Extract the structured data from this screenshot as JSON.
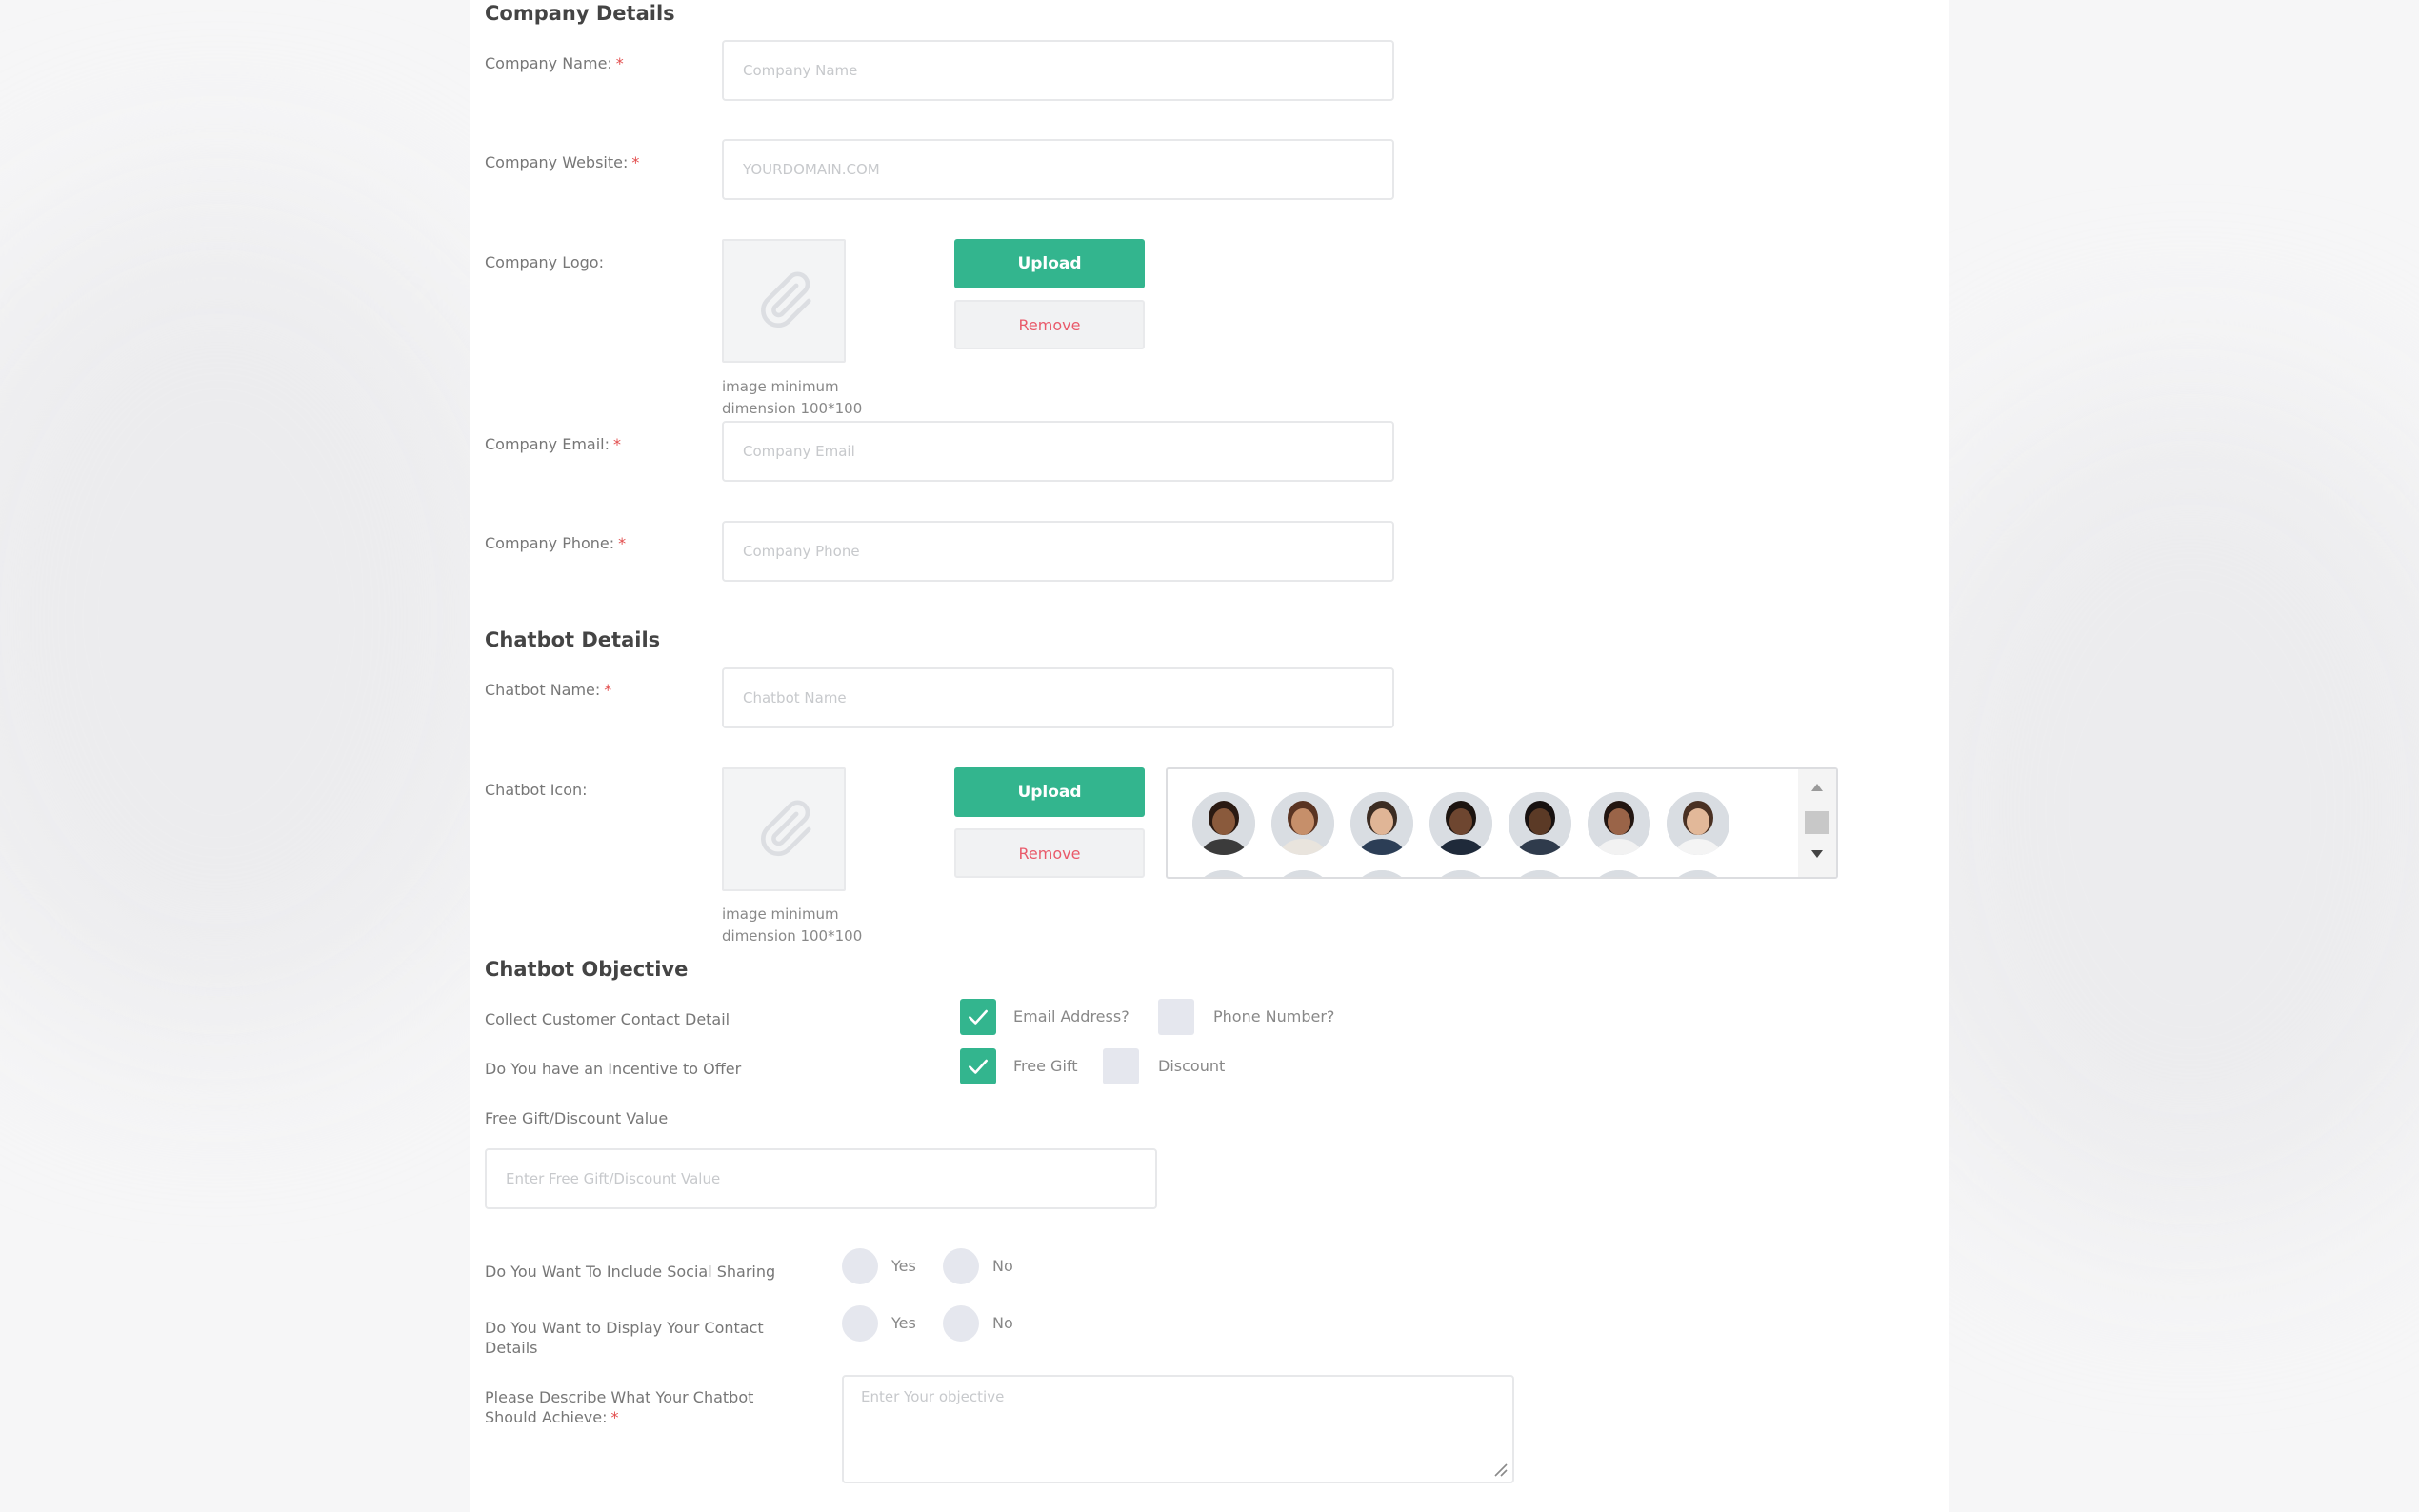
{
  "company": {
    "title": "Company Details",
    "name": {
      "label": "Company Name:",
      "required": "*",
      "placeholder": "Company Name",
      "value": ""
    },
    "website": {
      "label": "Company Website:",
      "required": "*",
      "placeholder": "YOURDOMAIN.COM",
      "value": ""
    },
    "logo": {
      "label": "Company Logo:",
      "upload": "Upload",
      "remove": "Remove",
      "hint_line1": "image minimum",
      "hint_line2": "dimension 100*100"
    },
    "email": {
      "label": "Company Email:",
      "required": "*",
      "placeholder": "Company Email",
      "value": ""
    },
    "phone": {
      "label": "Company Phone:",
      "required": "*",
      "placeholder": "Company Phone",
      "value": ""
    }
  },
  "chatbot": {
    "title": "Chatbot Details",
    "name": {
      "label": "Chatbot Name:",
      "required": "*",
      "placeholder": "Chatbot Name",
      "value": ""
    },
    "icon": {
      "label": "Chatbot Icon:",
      "upload": "Upload",
      "remove": "Remove",
      "hint_line1": "image minimum",
      "hint_line2": "dimension 100*100"
    },
    "avatars": [
      {
        "skin": "#8a5a3c",
        "hair": "#2a1a12",
        "shirt": "#3b3b3b"
      },
      {
        "skin": "#c68f6a",
        "hair": "#5a3422",
        "shirt": "#e9e4dd"
      },
      {
        "skin": "#e0b596",
        "hair": "#3c2c22",
        "shirt": "#2c3e56"
      },
      {
        "skin": "#6e4630",
        "hair": "#1c1410",
        "shirt": "#1f2a3a"
      },
      {
        "skin": "#5b3a26",
        "hair": "#171110",
        "shirt": "#2f3b4c"
      },
      {
        "skin": "#9a6448",
        "hair": "#231611",
        "shirt": "#f2f2f2"
      },
      {
        "skin": "#e2b899",
        "hair": "#4a3123",
        "shirt": "#f4f4f4"
      }
    ]
  },
  "objective": {
    "title": "Chatbot Objective",
    "contact": {
      "label": "Collect Customer Contact Detail",
      "opt1": "Email Address?",
      "opt1_checked": true,
      "opt2": "Phone Number?",
      "opt2_checked": false
    },
    "incentive": {
      "label": "Do You have an Incentive to Offer",
      "opt1": "Free Gift",
      "opt1_checked": true,
      "opt2": "Discount",
      "opt2_checked": false
    },
    "gift_value": {
      "label": "Free Gift/Discount Value",
      "placeholder": "Enter Free Gift/Discount Value",
      "value": ""
    },
    "social": {
      "label": "Do You Want To Include Social Sharing",
      "yes": "Yes",
      "no": "No"
    },
    "display_contact": {
      "label": "Do You Want to Display Your Contact Details",
      "yes": "Yes",
      "no": "No"
    },
    "describe": {
      "label": "Please Describe What Your Chatbot Should Achieve:",
      "required": "*",
      "placeholder": "Enter Your objective",
      "value": ""
    }
  },
  "colors": {
    "accent": "#33b58e",
    "remove_text": "#e95a6a",
    "required": "#e24c4c"
  }
}
